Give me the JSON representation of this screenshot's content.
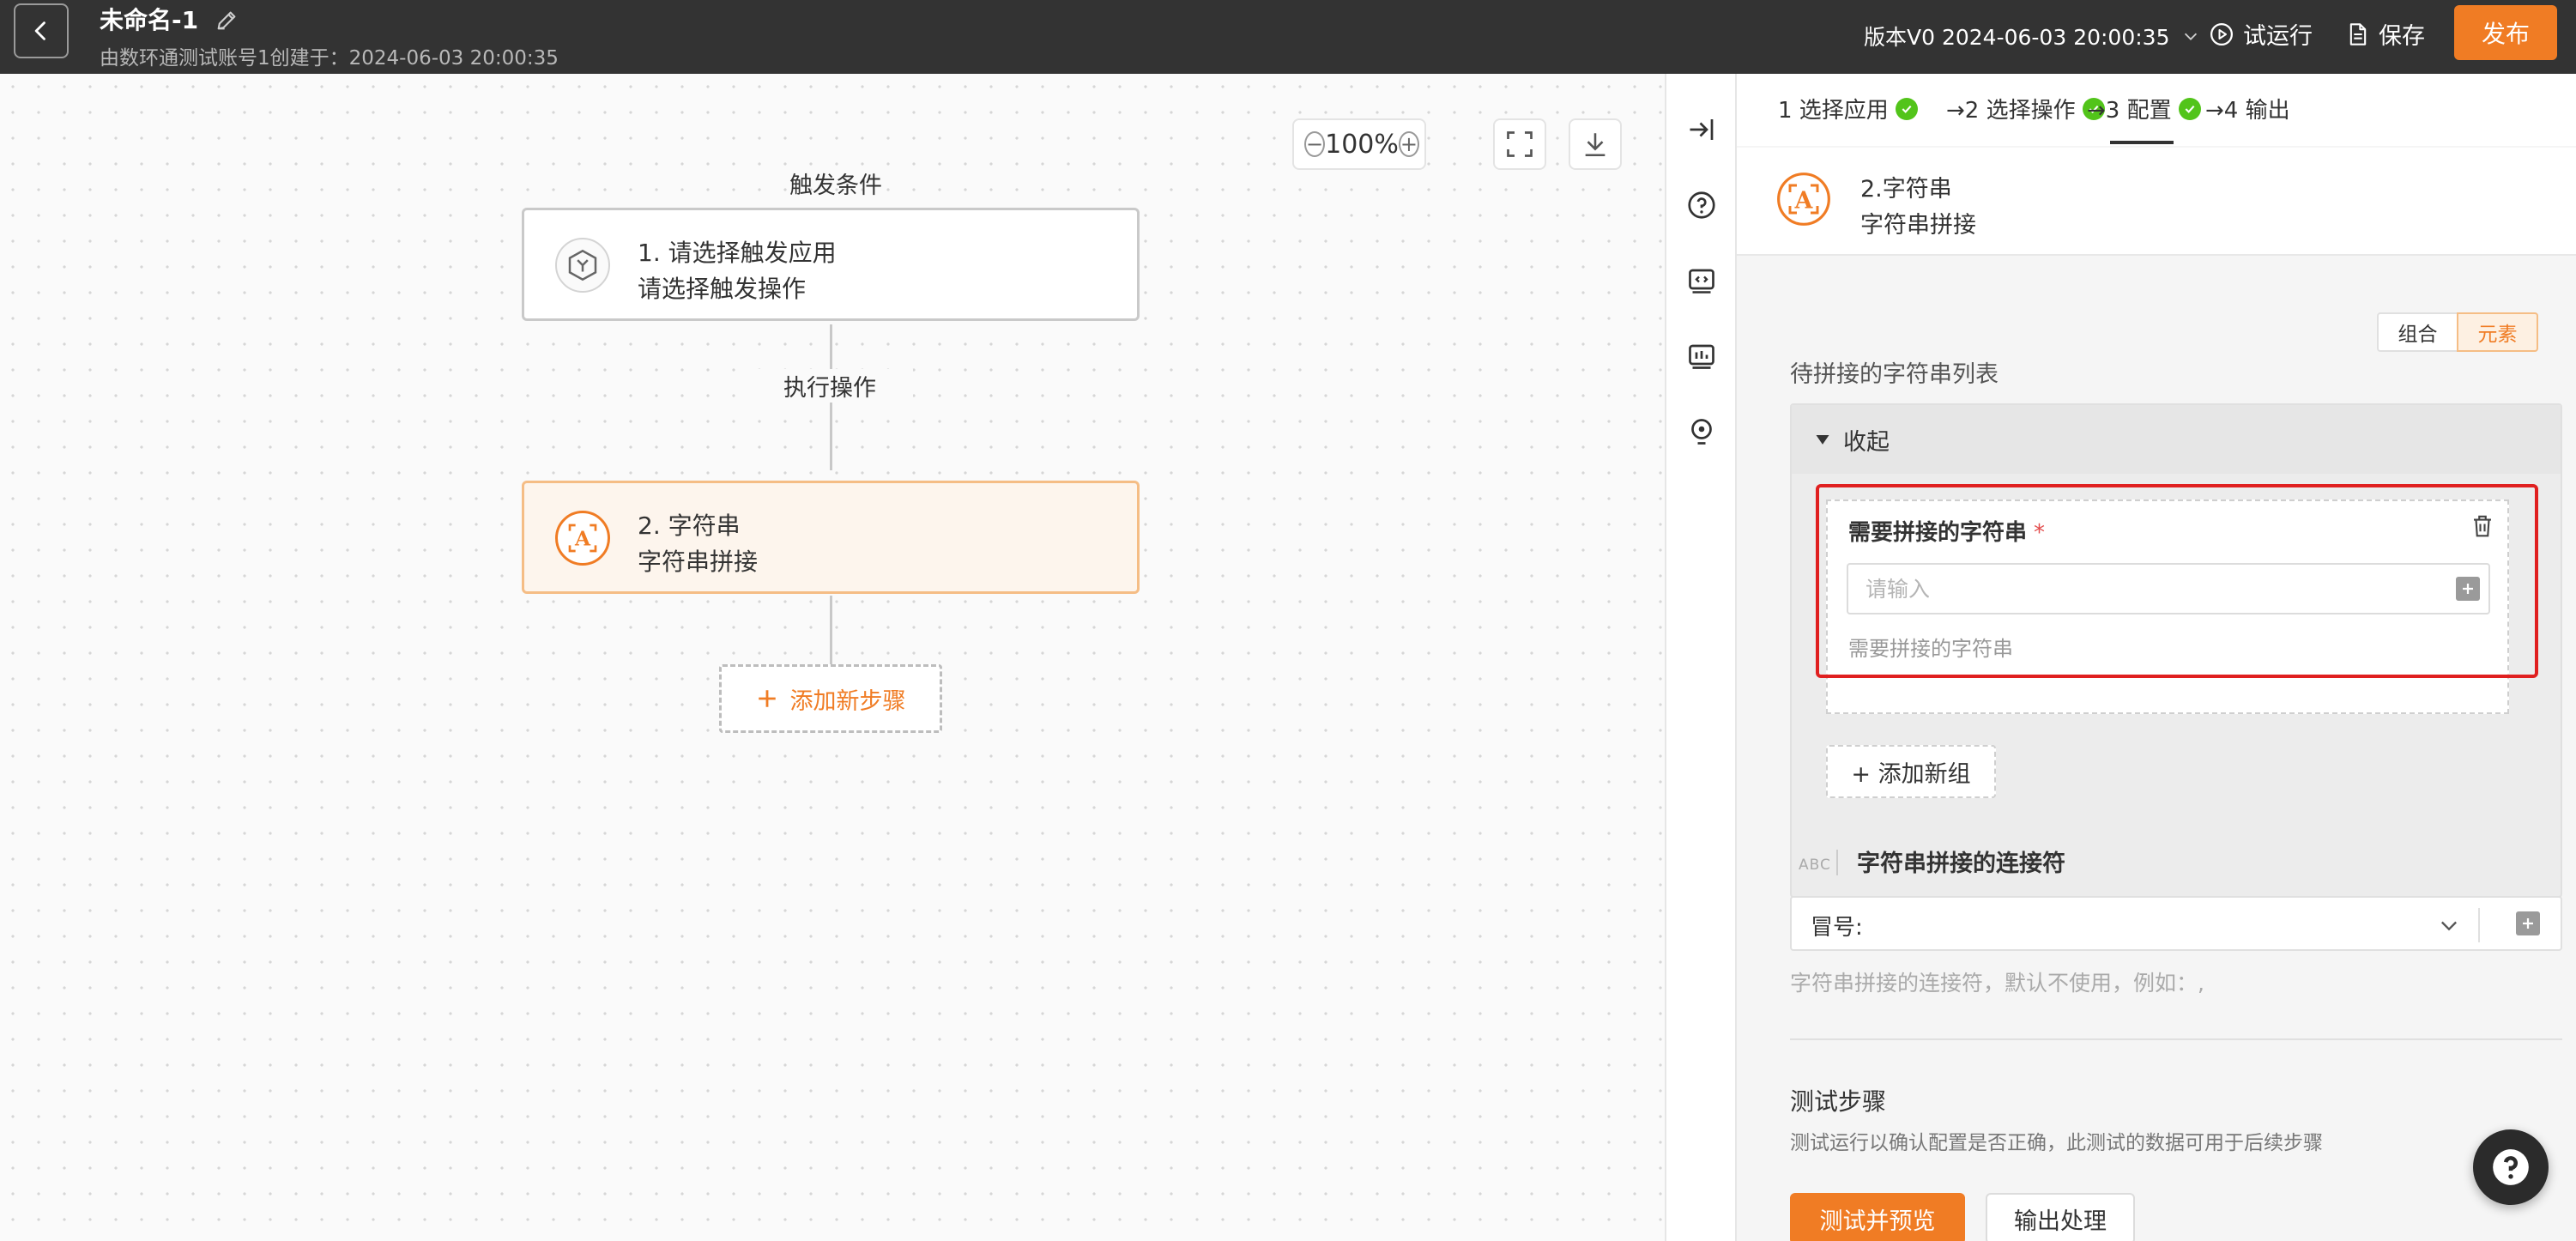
{
  "header": {
    "title": "未命名-1",
    "subtitle": "由数环通测试账号1创建于：2024-06-03 20:00:35",
    "version": "版本V0 2024-06-03 20:00:35",
    "trial_run": "试运行",
    "save": "保存",
    "publish": "发布"
  },
  "canvas": {
    "zoom": "100%",
    "trigger_label": "触发条件",
    "action_label": "执行操作",
    "nodes": [
      {
        "line1": "1. 请选择触发应用",
        "line2": "请选择触发操作"
      },
      {
        "line1": "2. 字符串",
        "line2": "字符串拼接"
      }
    ],
    "add_step": "添加新步骤"
  },
  "panel": {
    "steps": [
      {
        "label": "1 选择应用"
      },
      {
        "label": "→2 选择操作"
      },
      {
        "label": "→3 配置"
      },
      {
        "label": "→4 输出"
      }
    ],
    "app": {
      "name": "2.字符串",
      "action": "字符串拼接"
    },
    "mode_toggle": {
      "option1": "组合",
      "option2": "元素",
      "selected": "元素"
    },
    "list_label": "待拼接的字符串列表",
    "collapse_label": "收起",
    "field": {
      "title": "需要拼接的字符串",
      "required_mark": "*",
      "placeholder": "请输入",
      "hint": "需要拼接的字符串"
    },
    "add_group": "+ 添加新组",
    "abc_tag": "ABC",
    "connector": {
      "title": "字符串拼接的连接符",
      "value": "冒号:",
      "hint": "字符串拼接的连接符，默认不使用，例如：,"
    },
    "test": {
      "title": "测试步骤",
      "desc": "测试运行以确认配置是否正确，此测试的数据可用于后续步骤",
      "preview_button": "测试并预览",
      "output_button": "输出处理"
    }
  },
  "colors": {
    "accent": "#f07c24",
    "header_bg": "#333333",
    "success": "#52c41a",
    "highlight_frame": "#e02020"
  }
}
